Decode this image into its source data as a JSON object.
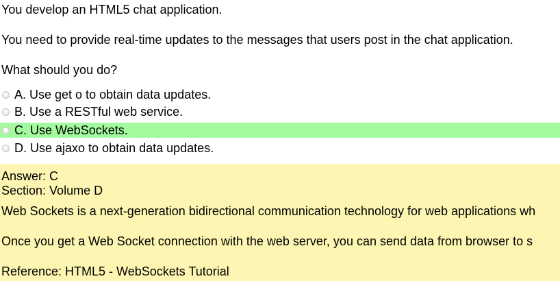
{
  "question": {
    "intro": "You develop an HTML5 chat application.",
    "requirement": "You need to provide real-time updates to the messages that users post in the chat application.",
    "prompt": "What should you do?"
  },
  "options": [
    {
      "letter": "A.",
      "text": "Use get o to obtain data updates."
    },
    {
      "letter": "B.",
      "text": "Use a RESTful web service."
    },
    {
      "letter": "C.",
      "text": "Use WebSockets."
    },
    {
      "letter": "D.",
      "text": "Use ajaxo to obtain data updates."
    }
  ],
  "answer": {
    "answer_line": "Answer: C",
    "section_line": "Section: Volume D",
    "explanation_1": "Web Sockets is a next-generation bidirectional communication technology for web applications wh",
    "explanation_2": "Once you get a Web Socket connection with the web server, you can send data from browser to s",
    "reference": "Reference: HTML5 - WebSockets Tutorial"
  },
  "colors": {
    "correct_highlight": "#a3fa9e",
    "answer_background": "#fdf6b2"
  }
}
